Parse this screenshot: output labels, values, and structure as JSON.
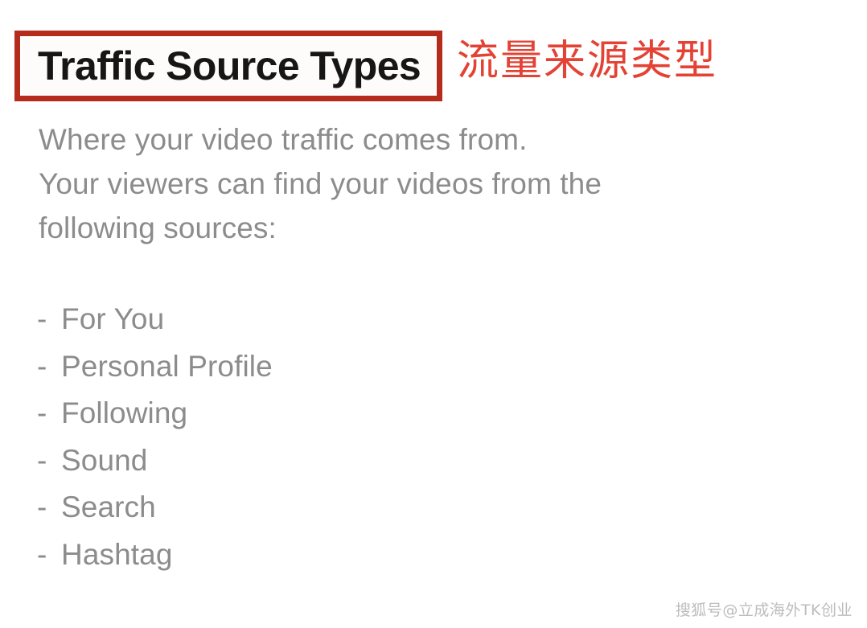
{
  "heading": {
    "title_en": "Traffic Source Types",
    "title_cn": "流量来源类型",
    "box_border_color": "#b52b1c",
    "title_cn_color": "#e34234"
  },
  "body": {
    "line1": "Where your video traffic comes from.",
    "line2": "Your viewers can find your videos from the",
    "line3": "following sources:",
    "text_color": "#8c8c8c"
  },
  "sources": {
    "items": [
      {
        "dash": "-",
        "label": "For You"
      },
      {
        "dash": "-",
        "label": "Personal Profile"
      },
      {
        "dash": "-",
        "label": "Following"
      },
      {
        "dash": "-",
        "label": "Sound"
      },
      {
        "dash": "-",
        "label": "Search"
      },
      {
        "dash": "-",
        "label": "Hashtag"
      }
    ]
  },
  "watermark": {
    "text": "搜狐号@立成海外TK创业"
  }
}
